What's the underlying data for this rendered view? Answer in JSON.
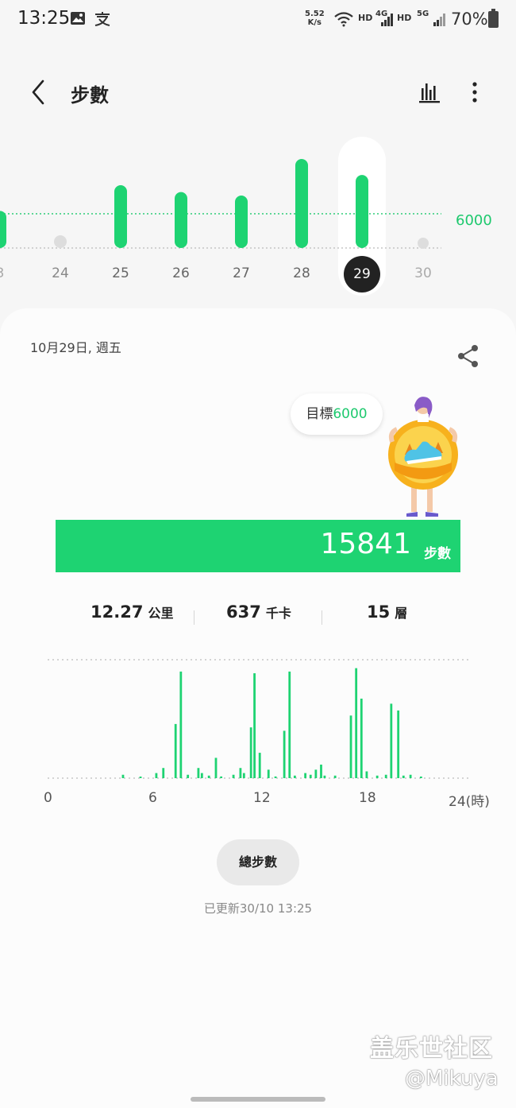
{
  "status_bar": {
    "time": "13:25",
    "speed_value": "5.52",
    "speed_unit": "K/s",
    "net1": "HD",
    "net2": "4G",
    "net3": "HD",
    "net4": "5G",
    "battery": "70%",
    "icons": [
      "image-icon",
      "alipay-icon",
      "wifi-icon",
      "signal-icon",
      "battery-icon"
    ]
  },
  "header": {
    "title": "步數",
    "icons": [
      "back-icon",
      "bar-chart-icon",
      "more-vertical-icon"
    ]
  },
  "week_chart": {
    "target_label": "6000",
    "days": [
      "3",
      "24",
      "25",
      "26",
      "27",
      "28",
      "29",
      "30"
    ],
    "selected_day": "29"
  },
  "card": {
    "date": "10月29日, 週五",
    "goal_label": "目標",
    "goal_value": "6000",
    "steps": "15841",
    "steps_unit": "步數",
    "distance_value": "12.27",
    "distance_unit": "公里",
    "calories_value": "637",
    "calories_unit": "千卡",
    "floors_value": "15",
    "floors_unit": "層",
    "hour_labels": [
      "0",
      "6",
      "12",
      "18",
      "24(時)"
    ],
    "total_button": "總步數",
    "updated": "已更新30/10 13:25"
  },
  "watermark": {
    "line1": "盖乐世社区",
    "line2": "@Mikuya"
  },
  "colors": {
    "accent": "#1ed372",
    "accent_text": "#1ec96e",
    "selected_day_bg": "#222222"
  },
  "chart_data": [
    {
      "type": "bar",
      "categories": [
        "3",
        "24",
        "25",
        "26",
        "27",
        "28",
        "29",
        "30"
      ],
      "values": [
        6500,
        600,
        11000,
        9800,
        9200,
        15600,
        12800,
        0
      ],
      "target": 6000,
      "ylim": [
        0,
        17000
      ]
    },
    {
      "type": "bar",
      "x": [
        4.3,
        5.3,
        6.2,
        6.6,
        7.3,
        7.6,
        8,
        8.6,
        8.8,
        9.2,
        9.6,
        9.9,
        10.6,
        11,
        11.2,
        11.6,
        11.8,
        12.1,
        12.6,
        13,
        13.5,
        13.8,
        14.1,
        14.7,
        15,
        15.3,
        15.6,
        15.8,
        16.4,
        17.3,
        17.6,
        17.9,
        18.2,
        18.8,
        19.3,
        19.6,
        20,
        20.3,
        20.7,
        21.3
      ],
      "values": [
        200,
        80,
        300,
        600,
        3200,
        6300,
        200,
        600,
        300,
        150,
        1200,
        100,
        200,
        600,
        300,
        3000,
        6200,
        1500,
        500,
        100,
        2800,
        6300,
        150,
        300,
        200,
        500,
        800,
        150,
        150,
        3700,
        6500,
        4700,
        400,
        150,
        200,
        4400,
        4000,
        150,
        200,
        80
      ],
      "xlim": [
        0,
        24
      ],
      "ylim": [
        0,
        7000
      ]
    }
  ]
}
